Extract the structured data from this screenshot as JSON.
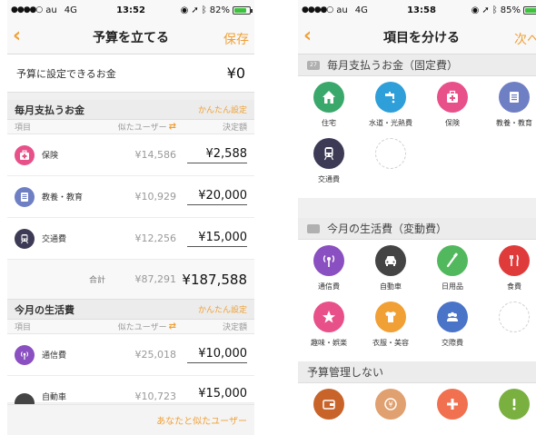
{
  "colors": {
    "accent": "#f0a035"
  },
  "left": {
    "status": {
      "carrier": "au",
      "network": "4G",
      "time": "13:52",
      "battery": "82%",
      "battery_level": 0.82
    },
    "nav": {
      "back": "<",
      "title": "予算を立てる",
      "action": "保存"
    },
    "budget": {
      "label": "予算に設定できるお金",
      "value": "¥0"
    },
    "section1": {
      "name": "毎月支払うお金",
      "easy": "かんたん設定",
      "col_item": "項目",
      "col_similar": "似たユーザー",
      "col_amount": "決定額",
      "rows": [
        {
          "name": "保険",
          "similar": "¥14,586",
          "amount": "¥2,588",
          "icon": "first-aid-icon",
          "color": "#e8508a"
        },
        {
          "name": "教養・教育",
          "similar": "¥10,929",
          "amount": "¥20,000",
          "icon": "book-icon",
          "color": "#6f7fc4"
        },
        {
          "name": "交通費",
          "similar": "¥12,256",
          "amount": "¥15,000",
          "icon": "train-icon",
          "color": "#3c3a55"
        }
      ],
      "total_label": "合計",
      "total_similar": "¥87,291",
      "total_amount": "¥187,588"
    },
    "section2": {
      "name": "今月の生活費",
      "easy": "かんたん設定",
      "col_item": "項目",
      "col_similar": "似たユーザー",
      "col_amount": "決定額",
      "rows": [
        {
          "name": "通信費",
          "similar": "¥25,018",
          "amount": "¥10,000",
          "icon": "signal-icon",
          "color": "#8a4fc0"
        },
        {
          "name": "自動車",
          "similar": "¥10,723",
          "amount": "¥15,000",
          "icon": "car-icon",
          "color": "#444444"
        }
      ]
    },
    "footer_link": "あなたと似たユーザー"
  },
  "right": {
    "status": {
      "carrier": "au",
      "network": "4G",
      "time": "13:58",
      "battery": "85%",
      "battery_level": 0.85
    },
    "nav": {
      "back": "<",
      "title": "項目を分ける",
      "action": "次へ"
    },
    "fixed": {
      "name": "毎月支払うお金（固定費）",
      "items": [
        {
          "label": "住宅",
          "icon": "house-icon",
          "color": "#3aa86b"
        },
        {
          "label": "水道・光熱費",
          "icon": "faucet-icon",
          "color": "#2e9fd8"
        },
        {
          "label": "保険",
          "icon": "first-aid-icon",
          "color": "#e8508a"
        },
        {
          "label": "教養・教育",
          "icon": "book-icon",
          "color": "#6f7fc4"
        },
        {
          "label": "交通費",
          "icon": "train-icon",
          "color": "#3c3a55"
        }
      ]
    },
    "variable": {
      "name": "今月の生活費（変動費）",
      "items": [
        {
          "label": "通信費",
          "icon": "signal-icon",
          "color": "#8a4fc0"
        },
        {
          "label": "自動車",
          "icon": "car-icon",
          "color": "#444444"
        },
        {
          "label": "日用品",
          "icon": "toothbrush-icon",
          "color": "#52b85e"
        },
        {
          "label": "食費",
          "icon": "fork-knife-icon",
          "color": "#e03b3b"
        },
        {
          "label": "趣味・娯楽",
          "icon": "star-icon",
          "color": "#e8508a"
        },
        {
          "label": "衣服・美容",
          "icon": "shirt-icon",
          "color": "#f0a035"
        },
        {
          "label": "交際費",
          "icon": "people-icon",
          "color": "#4a74c8"
        }
      ]
    },
    "unmanaged": {
      "name": "予算管理しない",
      "items": [
        {
          "icon": "wallet-icon",
          "color": "#c8642a"
        },
        {
          "icon": "yen-coin-icon",
          "color": "#e0a070"
        },
        {
          "icon": "plus-icon",
          "color": "#f07050"
        },
        {
          "icon": "exclamation-icon",
          "color": "#7ab040"
        }
      ]
    }
  }
}
